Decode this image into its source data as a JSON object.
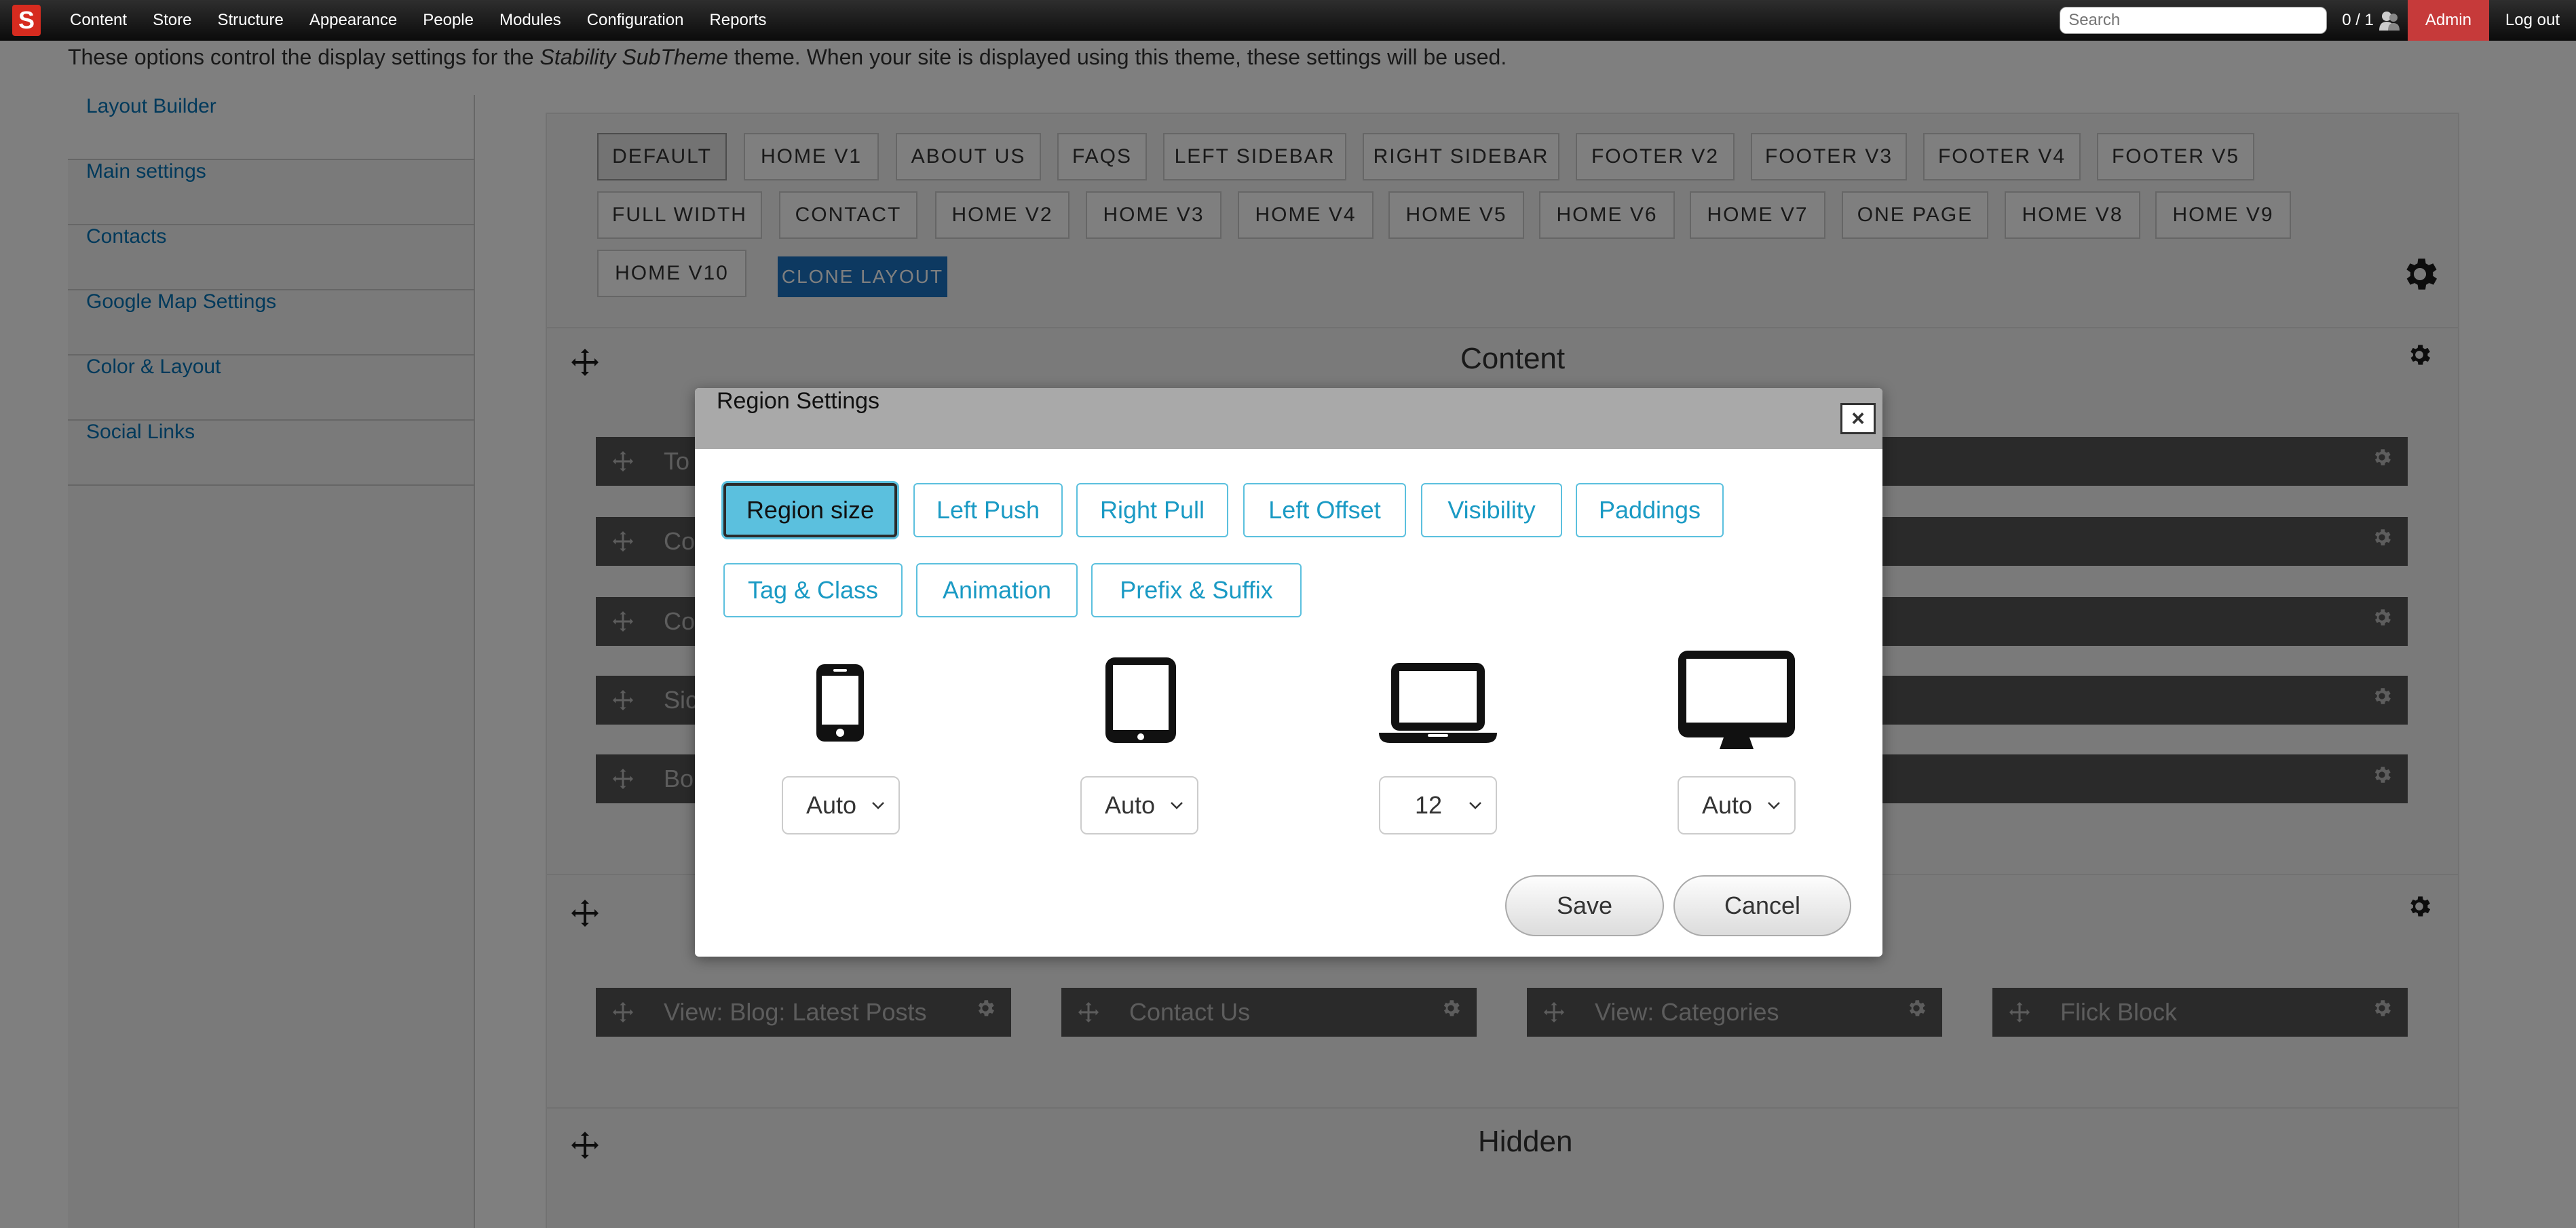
{
  "toolbar": {
    "logo": "S",
    "menu": [
      "Content",
      "Store",
      "Structure",
      "Appearance",
      "People",
      "Modules",
      "Configuration",
      "Reports"
    ],
    "search_placeholder": "Search",
    "user_count": "0 / 1",
    "admin_label": "Admin",
    "logout_label": "Log out"
  },
  "description": {
    "before": "These options control the display settings for the ",
    "theme": "Stability SubTheme",
    "after": " theme. When your site is displayed using this theme, these settings will be used."
  },
  "sidebar": {
    "items": [
      "Layout Builder",
      "Main settings",
      "Contacts",
      "Google Map Settings",
      "Color & Layout",
      "Social Links"
    ]
  },
  "layouts": {
    "tabs": [
      "DEFAULT",
      "HOME V1",
      "ABOUT US",
      "FAQS",
      "LEFT SIDEBAR",
      "RIGHT SIDEBAR",
      "FOOTER V2",
      "FOOTER V3",
      "FOOTER V4",
      "FOOTER V5",
      "FULL WIDTH",
      "CONTACT",
      "HOME V2",
      "HOME V3",
      "HOME V4",
      "HOME V5",
      "HOME V6",
      "HOME V7",
      "ONE PAGE",
      "HOME V8",
      "HOME V9",
      "HOME V10"
    ],
    "active": "DEFAULT",
    "clone_label": "CLONE LAYOUT"
  },
  "sections": {
    "content_title": "Content",
    "content_regions": [
      "To",
      "Co",
      "Co",
      "Sic",
      "Bo"
    ],
    "footer_blocks": [
      "View: Blog: Latest Posts",
      "Contact Us",
      "View: Categories",
      "Flick Block"
    ],
    "hidden_title": "Hidden"
  },
  "modal": {
    "title": "Region Settings",
    "close": "×",
    "tabs": [
      "Region size",
      "Left Push",
      "Right Pull",
      "Left Offset",
      "Visibility",
      "Paddings",
      "Tag & Class",
      "Animation",
      "Prefix & Suffix"
    ],
    "active_tab": "Region size",
    "devices": [
      {
        "icon": "phone-icon",
        "value": "Auto"
      },
      {
        "icon": "tablet-icon",
        "value": "Auto"
      },
      {
        "icon": "laptop-icon",
        "value": "12"
      },
      {
        "icon": "desktop-icon",
        "value": "Auto"
      }
    ],
    "save_label": "Save",
    "cancel_label": "Cancel"
  },
  "colors": {
    "toolbar": "#1a1a1a",
    "logo": "#d62b1f",
    "admin": "#c63a3a",
    "link": "#0073b6",
    "clone_button": "#1a73c2",
    "active_tab": "#5bc0de",
    "region_bar": "#555555"
  }
}
